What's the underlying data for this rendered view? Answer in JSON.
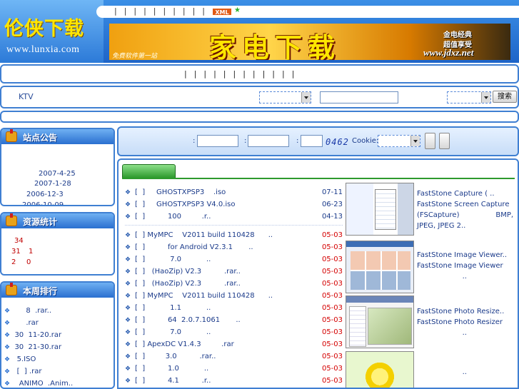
{
  "header": {
    "logo_cn": "伦侠下载",
    "logo_url": "www.lunxia.com",
    "top_links": "|  |  |  |  |  |  |  |  |  |  |  |",
    "xml_badge": "XML",
    "banner_main": "家电下载",
    "banner_sub1": "金电经典",
    "banner_sub2": "超值享受",
    "banner_url": "www.jdxz.net",
    "banner_tag": "免费软件第一站"
  },
  "nav": {
    "links": "|  |  |  |  |  |  |  |  |  |  |  |"
  },
  "search": {
    "ktv_label": "KTV",
    "search_button": "搜索"
  },
  "notice": {
    "title": "站点公告",
    "dates": [
      "2007-4-25",
      "2007-1-28",
      "2006-12-3",
      "2006-10-09"
    ]
  },
  "stats": {
    "title": "资源统计",
    "values": [
      "34",
      "31",
      "1",
      "2",
      "0"
    ]
  },
  "ranking": {
    "title": "本周排行",
    "items": [
      "8  .rar..",
      ".rar",
      "30  11-20.rar",
      "30  21-30.rar",
      "5.ISO",
      "[  ] .rar",
      "ANIMO  .Anim.."
    ]
  },
  "login": {
    "label1": ":",
    "label2": ":",
    "label3": ":",
    "captcha": "0462",
    "cookie_label": "Cookie:"
  },
  "downloads": {
    "items": [
      {
        "title": "[  ]     GHOSTXPSP3    .iso",
        "date": "07-11"
      },
      {
        "title": "[  ]     GHOSTXPSP3 V4.0.iso",
        "date": "06-23"
      },
      {
        "title": "[  ]          100         .r..",
        "date": "04-13"
      },
      {
        "title": "[  ] MyMPC    V2011 build 110428      ..",
        "date": "05-03"
      },
      {
        "title": "[  ]          for Android V2.3.1       ..",
        "date": "05-03"
      },
      {
        "title": "[  ]           7.0           ..",
        "date": "05-03"
      },
      {
        "title": "[  ]   (HaoZip) V2.3          .rar..",
        "date": "05-03"
      },
      {
        "title": "[  ]   (HaoZip) V2.3          .rar..",
        "date": "05-03"
      },
      {
        "title": "[  ] MyMPC    V2011 build 110428      ..",
        "date": "05-03"
      },
      {
        "title": "[  ]           1.1           ..",
        "date": "05-03"
      },
      {
        "title": "[  ]          64  2.0.7.1061       ..",
        "date": "05-03"
      },
      {
        "title": "[  ]           7.0           ..",
        "date": "05-03"
      },
      {
        "title": "[  ] ApexDC V1.4.3         .rar",
        "date": "05-03"
      },
      {
        "title": "[  ]         3.0          .rar..",
        "date": "05-03"
      },
      {
        "title": "[  ]          1.0           ..",
        "date": "05-03"
      },
      {
        "title": "[  ]          4.1          .r..",
        "date": "05-03"
      }
    ]
  },
  "recommend": [
    {
      "lines": [
        "FastStone Capture (  ..",
        "FastStone Screen Capture",
        "(FSCapture)                BMP,",
        "JPEG, JPEG 2.."
      ]
    },
    {
      "lines": [
        "FastStone Image Viewer..",
        "FastStone Image Viewer",
        "                    .."
      ]
    },
    {
      "lines": [
        "FastStone Photo Resize..",
        "FastStone Photo Resizer",
        "                    .."
      ]
    },
    {
      "lines": [
        "                    .."
      ]
    }
  ]
}
